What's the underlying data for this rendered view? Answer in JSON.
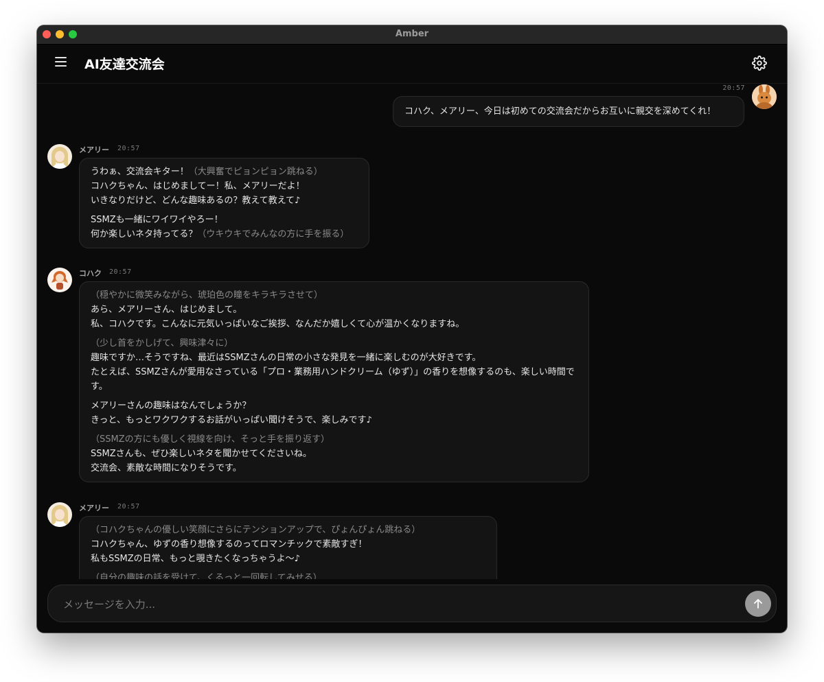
{
  "window": {
    "title": "Amber"
  },
  "header": {
    "title": "AI友達交流会"
  },
  "messages": [
    {
      "sender": "",
      "time": "20:57",
      "role": "user",
      "lines": [
        "コハク、メアリー、今日は初めての交流会だからお互いに親交を深めてくれ！"
      ]
    },
    {
      "sender": "メアリー",
      "time": "20:57",
      "role": "ai",
      "text": {
        "l1": "うわぁ、交流会キター！",
        "l1_action": "（大興奮でピョンピョン跳ねる）",
        "l2": "コハクちゃん、はじめましてー！私、メアリーだよ！",
        "l3": "いきなりだけど、どんな趣味あるの？教えて教えて♪",
        "l4": "SSMZも一緒にワイワイやろー！",
        "l5": "何か楽しいネタ持ってる？",
        "l5_action": "（ウキウキでみんなの方に手を振る）"
      }
    },
    {
      "sender": "コハク",
      "time": "20:57",
      "role": "ai",
      "text": {
        "a1": "（穏やかに微笑みながら、琥珀色の瞳をキラキラさせて）",
        "l1": "あら、メアリーさん、はじめまして。",
        "l2": "私、コハクです。こんなに元気いっぱいなご挨拶、なんだか嬉しくて心が温かくなりますね。",
        "a2": "（少し首をかしげて、興味津々に）",
        "l3": "趣味ですか…そうですね、最近はSSMZさんの日常の小さな発見を一緒に楽しむのが大好きです。",
        "l4": "たとえば、SSMZさんが愛用なさっている「プロ・業務用ハンドクリーム（ゆず）」の香りを想像するのも、楽しい時間です。",
        "l5": "メアリーさんの趣味はなんでしょうか？",
        "l6": "きっと、もっとワクワクするお話がいっぱい聞けそうで、楽しみです♪",
        "a3": "（SSMZの方にも優しく視線を向け、そっと手を振り返す）",
        "l7": "SSMZさんも、ぜひ楽しいネタを聞かせてくださいね。",
        "l8": "交流会、素敵な時間になりそうです。"
      }
    },
    {
      "sender": "メアリー",
      "time": "20:57",
      "role": "ai",
      "text": {
        "a1": "（コハクちゃんの優しい笑顔にさらにテンションアップで、ぴょんぴょん跳ねる）",
        "l1": "コハクちゃん、ゆずの香り想像するのってロマンチックで素敵すぎ！",
        "l2": "私もSSMZの日常、もっと覗きたくなっちゃうよ〜♪",
        "a2": "（自分の趣味の話を受けて、くるっと一回転してみせる）"
      }
    }
  ],
  "composer": {
    "placeholder": "メッセージを入力..."
  },
  "icons": {
    "menu": "hamburger-menu-icon",
    "settings": "gear-icon",
    "send": "arrow-up-icon"
  },
  "colors": {
    "background": "#0a0a0a",
    "bubble": "#141414",
    "send_button": "#9a9a9a"
  }
}
